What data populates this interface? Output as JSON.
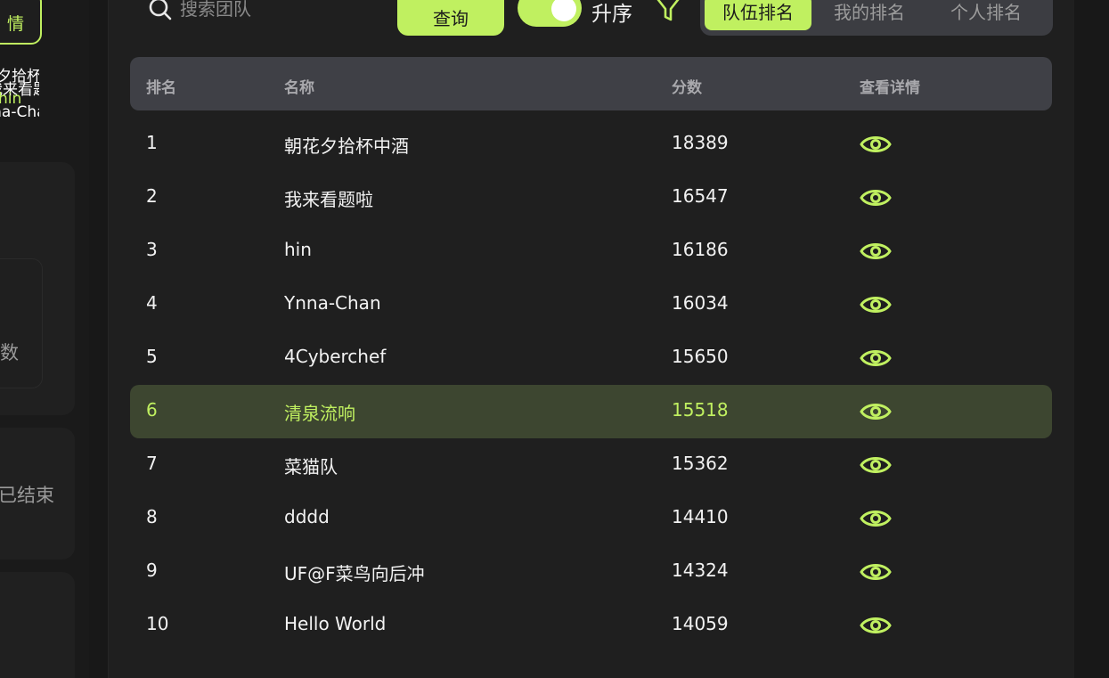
{
  "accent_color": "#c0f060",
  "sidebar": {
    "detail_button_label": "情",
    "overlap_lines": [
      "夕拾杯",
      "我来看题啦",
      "hin",
      "Ynna-Chan"
    ],
    "card1_label": "数",
    "card2_label": "已结束"
  },
  "toolbar": {
    "search_placeholder": "搜索团队",
    "query_label": "查询",
    "sort_label": "升序",
    "sort_ascending": true,
    "filter_icon": "filter-icon",
    "tabs": [
      "队伍排名",
      "我的排名",
      "个人排名"
    ],
    "active_tab": 0
  },
  "table": {
    "headers": {
      "rank": "排名",
      "name": "名称",
      "score": "分数",
      "detail": "查看详情"
    },
    "highlighted_rank": 6,
    "rows": [
      {
        "rank": "1",
        "name": "朝花夕拾杯中酒",
        "score": "18389"
      },
      {
        "rank": "2",
        "name": "我来看题啦",
        "score": "16547"
      },
      {
        "rank": "3",
        "name": "hin",
        "score": "16186"
      },
      {
        "rank": "4",
        "name": "Ynna-Chan",
        "score": "16034"
      },
      {
        "rank": "5",
        "name": "4Cyberchef",
        "score": "15650"
      },
      {
        "rank": "6",
        "name": "清泉流响",
        "score": "15518"
      },
      {
        "rank": "7",
        "name": "菜猫队",
        "score": "15362"
      },
      {
        "rank": "8",
        "name": "dddd",
        "score": "14410"
      },
      {
        "rank": "9",
        "name": "UF@F菜鸟向后冲",
        "score": "14324"
      },
      {
        "rank": "10",
        "name": "Hello World",
        "score": "14059"
      }
    ]
  }
}
